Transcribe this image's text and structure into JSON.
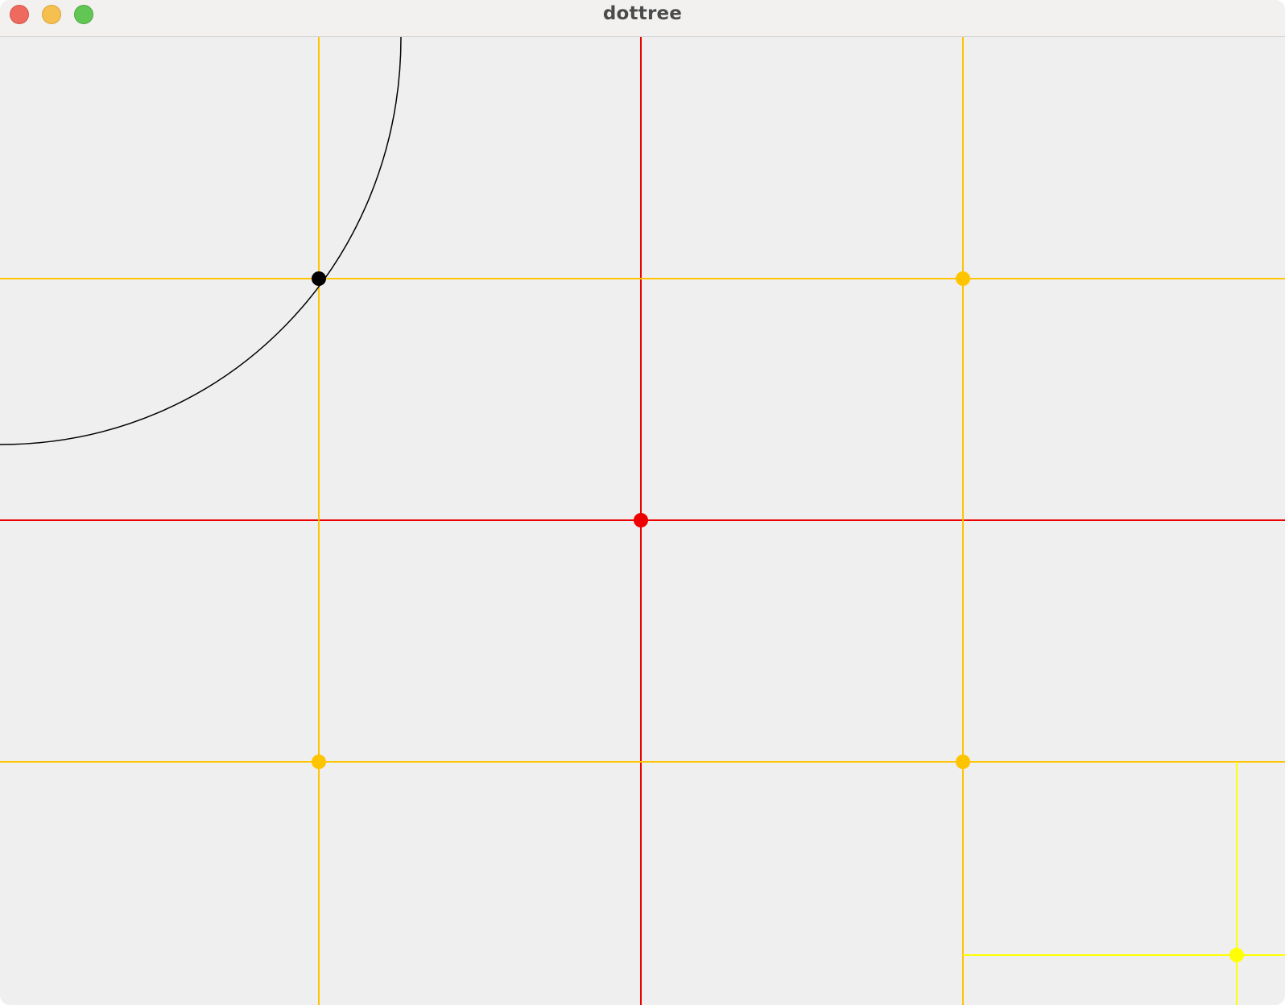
{
  "window": {
    "title": "dottree",
    "buttons": [
      "close-button",
      "minimize-button",
      "zoom-button"
    ]
  },
  "colors": {
    "canvas_bg": "#efefef",
    "root": "#ee0000",
    "level1": "#ffc400",
    "level2": "#ffff00",
    "marker": "#000000",
    "arc": "#000000"
  }
}
